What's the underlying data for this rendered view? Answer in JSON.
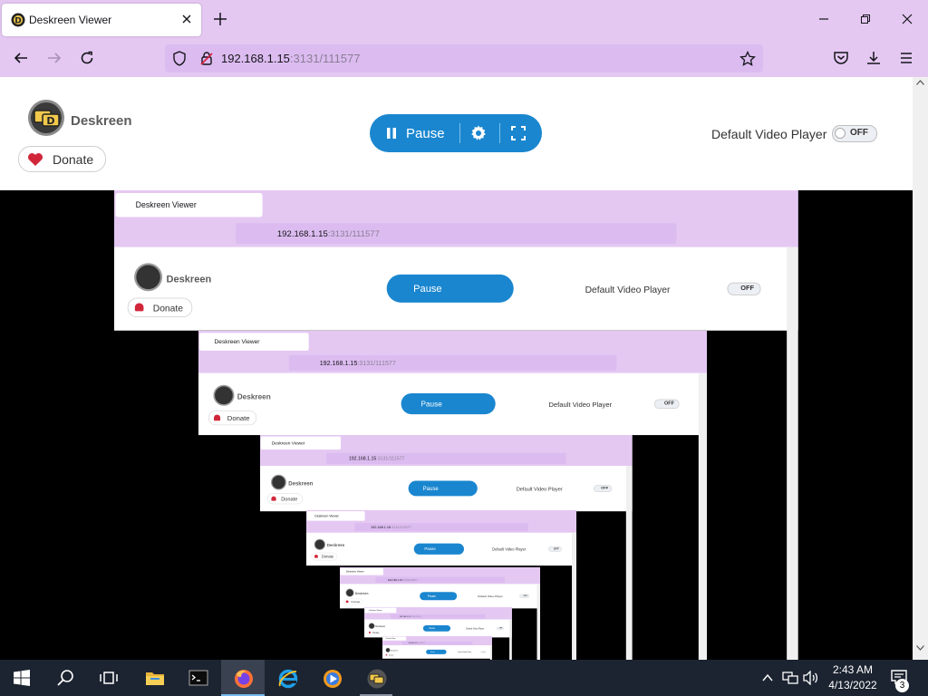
{
  "browser": {
    "tab_title": "Deskreen Viewer",
    "url_host": "192.168.1.15",
    "url_rest": ":3131/111577"
  },
  "app": {
    "brand_name": "Deskreen",
    "donate_label": "Donate",
    "pause_label": "Pause",
    "video_player_label": "Default Video Player",
    "video_player_toggle": "OFF",
    "accent_color": "#1a86cf"
  },
  "taskbar": {
    "time": "2:43 AM",
    "date": "4/13/2022",
    "notification_count": "3",
    "apps": [
      "start",
      "search",
      "task-view",
      "file-explorer",
      "terminal",
      "firefox",
      "internet-explorer",
      "media-player",
      "deskreen"
    ]
  }
}
